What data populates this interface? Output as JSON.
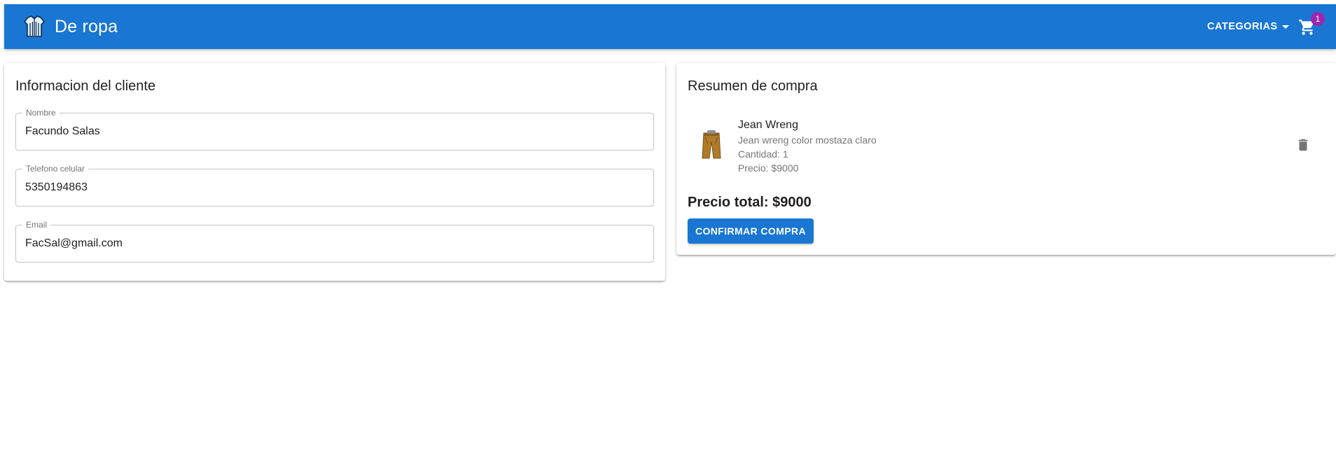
{
  "header": {
    "brand": "De ropa",
    "logo_icon": "shirt-logo-icon",
    "categorias_label": "CATEGORIAS",
    "cart_icon": "shopping-cart-icon",
    "cart_count": "1",
    "bar_color": "#1976d2",
    "badge_color": "#9c27b0"
  },
  "client": {
    "title": "Informacion del cliente",
    "fields": [
      {
        "label": "Nombre",
        "value": "Facundo Salas"
      },
      {
        "label": "Telefono celular",
        "value": "5350194863"
      },
      {
        "label": "Email",
        "value": "FacSal@gmail.com"
      }
    ]
  },
  "summary": {
    "title": "Resumen de compra",
    "items": [
      {
        "name": "Jean Wreng",
        "description": "Jean wreng color mostaza claro",
        "quantity": "Cantidad: 1",
        "price": "Precio: $9000",
        "image_icon": "pants-thumbnail",
        "delete_icon": "trash-icon"
      }
    ],
    "total": "Precio total: $9000",
    "confirm_label": "CONFIRMAR COMPRA"
  }
}
